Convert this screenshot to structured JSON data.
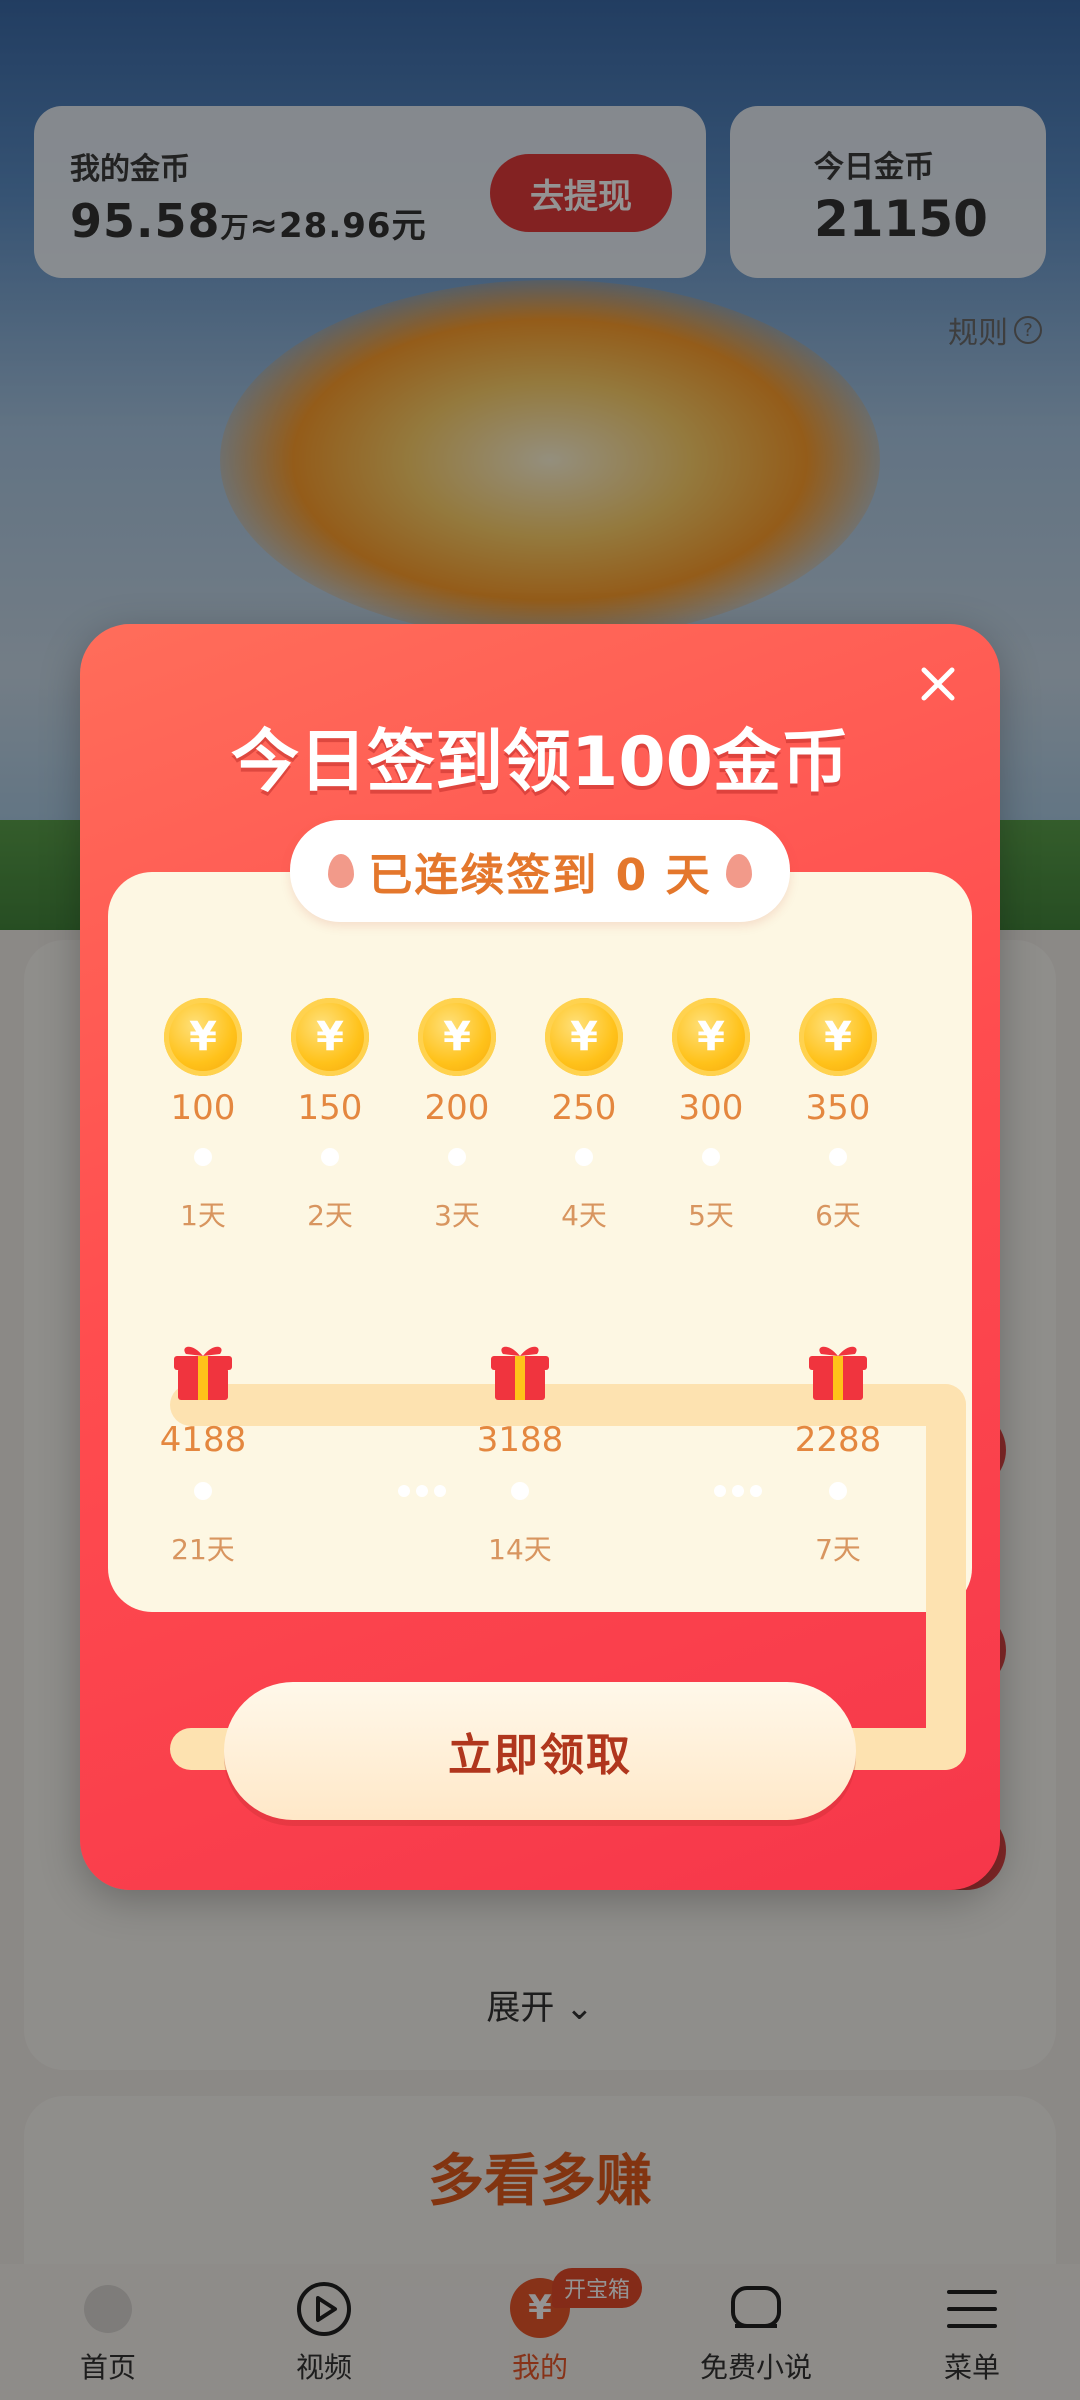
{
  "header": {
    "my_coins_label": "我的金币",
    "my_coins_value": "95.58",
    "my_coins_unit": "万",
    "my_coins_cash": "≈28.96元",
    "withdraw_label": "去提现",
    "today_coins_label": "今日金币",
    "today_coins_value": "21150",
    "rules_label": "规则"
  },
  "background": {
    "expand_label": "展开",
    "earn_title": "多看多赚"
  },
  "modal": {
    "title": "今日签到领100金币",
    "streak_text": "已连续签到 0 天",
    "claim_label": "立即领取",
    "daily_rewards": [
      {
        "amount": "100",
        "day": "1天"
      },
      {
        "amount": "150",
        "day": "2天"
      },
      {
        "amount": "200",
        "day": "3天"
      },
      {
        "amount": "250",
        "day": "4天"
      },
      {
        "amount": "300",
        "day": "5天"
      },
      {
        "amount": "350",
        "day": "6天"
      }
    ],
    "gift_rewards": [
      {
        "amount": "4188",
        "day": "21天"
      },
      {
        "amount": "3188",
        "day": "14天"
      },
      {
        "amount": "2288",
        "day": "7天"
      }
    ]
  },
  "nav": {
    "items": [
      {
        "label": "首页"
      },
      {
        "label": "视频"
      },
      {
        "label": "我的",
        "badge": "开宝箱"
      },
      {
        "label": "免费小说"
      },
      {
        "label": "菜单"
      }
    ]
  },
  "colors": {
    "modal_red": "#ff4d4f",
    "panel_cream": "#fdf7e3",
    "coin_gold": "#ffc21a",
    "reward_orange": "#e4873f"
  }
}
